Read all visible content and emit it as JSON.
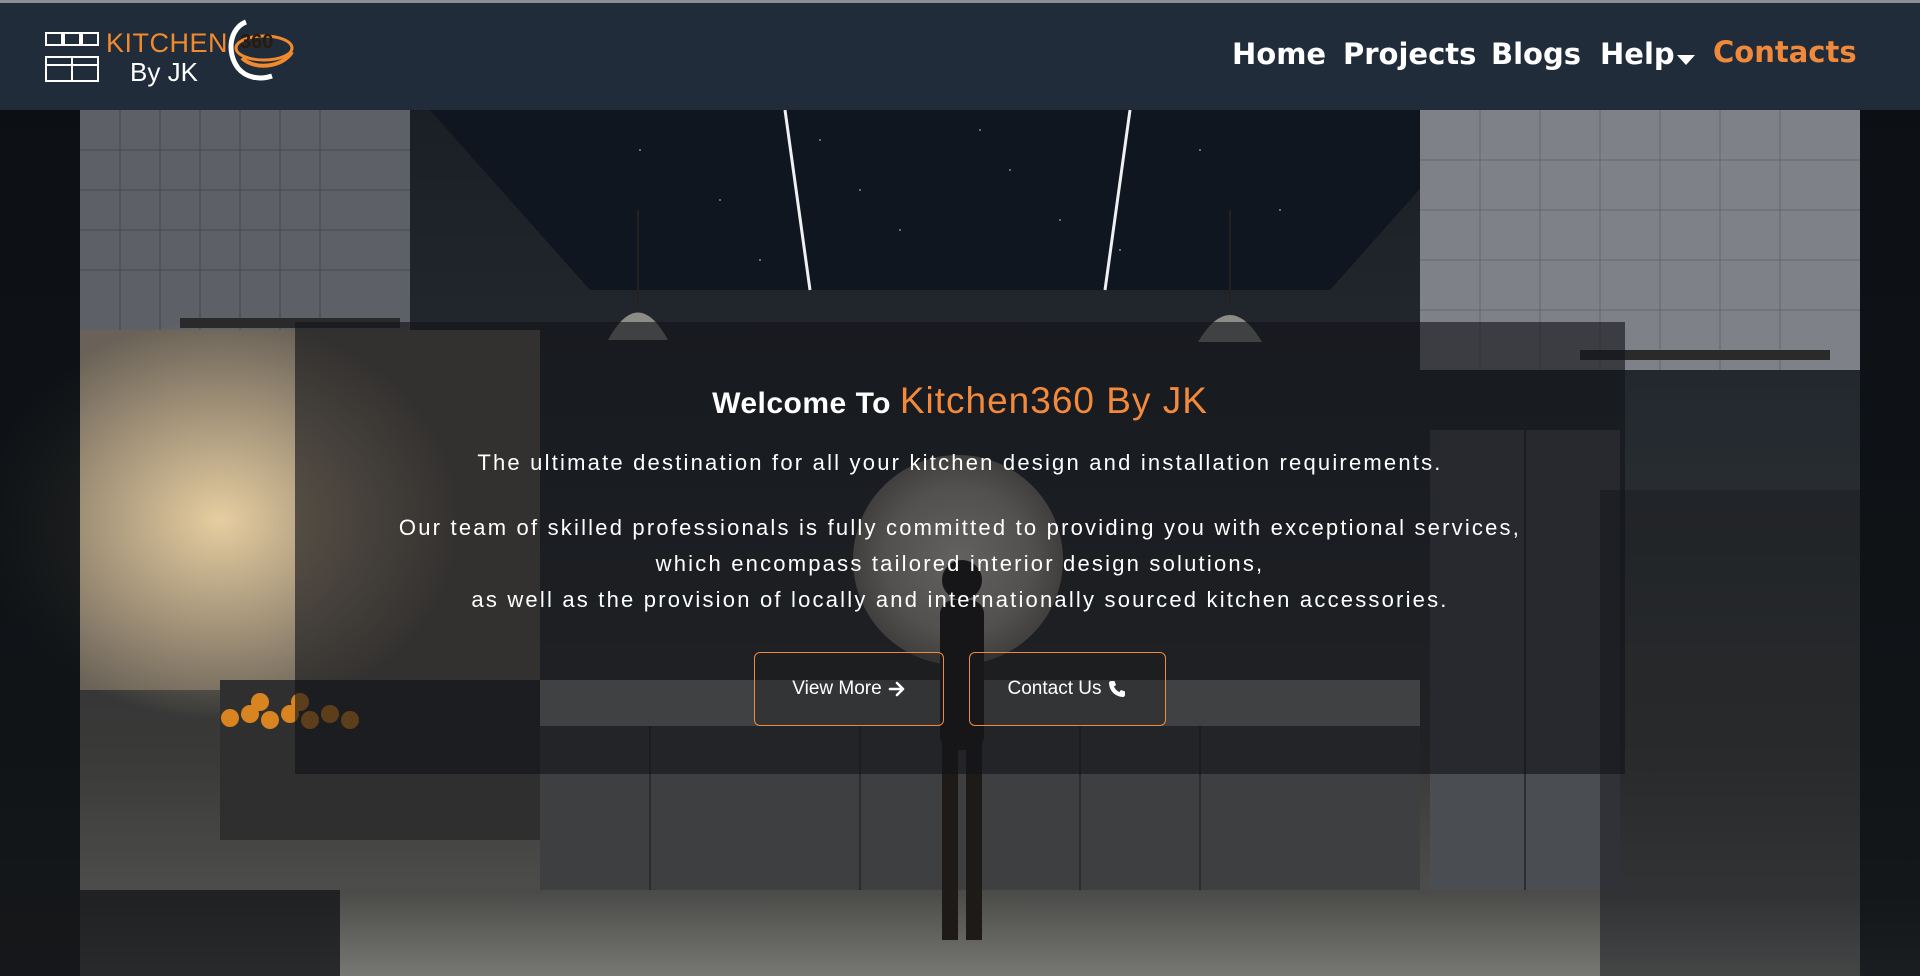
{
  "logo": {
    "line1": "KITCHEN",
    "line2": "By JK",
    "badge": "360",
    "icon": "kitchen-cabinet-icon"
  },
  "nav": {
    "items": [
      {
        "label": "Home"
      },
      {
        "label": "Projects"
      },
      {
        "label": "Blogs"
      },
      {
        "label": "Help",
        "icon": "caret-down-icon"
      },
      {
        "label": "Contacts"
      }
    ]
  },
  "hero": {
    "welcome_prefix": "Welcome To",
    "welcome_brand": "Kitchen360 By JK",
    "lead": "The ultimate destination for all your kitchen design and installation requirements.",
    "paragraph_lines": [
      "Our team of skilled professionals is fully committed to providing you with exceptional services,",
      "which encompass tailored interior design solutions,",
      "as well as the provision of locally and internationally sourced kitchen accessories."
    ],
    "buttons": {
      "view_more": "View More",
      "view_more_icon": "arrow-right-icon",
      "contact_us": "Contact Us",
      "contact_us_icon": "phone-icon"
    }
  },
  "colors": {
    "navbar_bg": "#202c3a",
    "accent": "#f08a3a",
    "overlay": "rgba(18,20,24,0.62)"
  }
}
